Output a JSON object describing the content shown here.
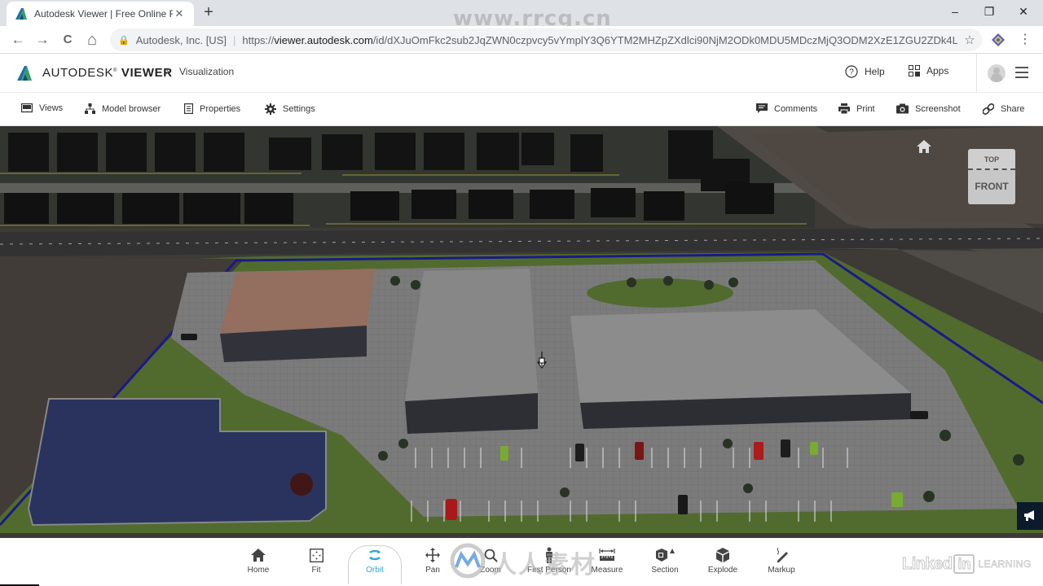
{
  "browser": {
    "tab_title": "Autodesk Viewer | Free Online Fi",
    "tab_close": "✕",
    "new_tab": "+",
    "watermark": "www.rrcg.cn",
    "window_controls": {
      "minimize": "–",
      "restore": "❐",
      "close": "✕"
    },
    "nav": {
      "back": "←",
      "forward": "→",
      "reload": "C",
      "home": "⌂"
    },
    "omnibox": {
      "lock": "🔒",
      "site_identity": "Autodesk, Inc. [US]",
      "separator": "|",
      "url_prefix": "https://",
      "url_host": "viewer.autodesk.com",
      "url_path": "/id/dXJuOmFkc2sub2JqZWN0czpvcy5vYmplY3Q6YTM2MHZpZXdlci90NjM2ODk0MDU5MDczMjQ3ODM2XzE1ZGU2ZDk4L...",
      "star": "☆"
    },
    "menu": "⋮"
  },
  "app": {
    "brand_prefix": "AUTODESK",
    "brand_mark": "®",
    "brand_product": "VIEWER",
    "breadcrumb_chevron": "›",
    "breadcrumb": "Visualization",
    "header_actions": [
      {
        "id": "help",
        "label": "Help",
        "icon": "help-circle-icon"
      },
      {
        "id": "apps",
        "label": "Apps",
        "icon": "apps-grid-icon"
      }
    ],
    "colors": {
      "accent": "#2fa8d8",
      "logo_green": "#3a9b6a",
      "logo_blue": "#1e6fa8"
    }
  },
  "subtoolbar": {
    "left": [
      {
        "id": "views",
        "label": "Views",
        "icon": "monitor-icon"
      },
      {
        "id": "model-browser",
        "label": "Model browser",
        "icon": "hierarchy-icon"
      },
      {
        "id": "properties",
        "label": "Properties",
        "icon": "document-icon"
      },
      {
        "id": "settings",
        "label": "Settings",
        "icon": "gear-icon"
      }
    ],
    "right": [
      {
        "id": "comments",
        "label": "Comments",
        "icon": "comment-icon"
      },
      {
        "id": "print",
        "label": "Print",
        "icon": "printer-icon"
      },
      {
        "id": "screenshot",
        "label": "Screenshot",
        "icon": "camera-icon"
      },
      {
        "id": "share",
        "label": "Share",
        "icon": "link-icon"
      }
    ]
  },
  "viewcube": {
    "top": "TOP",
    "front": "FRONT"
  },
  "tools": [
    {
      "id": "home",
      "label": "Home",
      "icon": "home-icon",
      "active": false
    },
    {
      "id": "fit",
      "label": "Fit",
      "icon": "fit-icon",
      "active": false
    },
    {
      "id": "orbit",
      "label": "Orbit",
      "icon": "orbit-icon",
      "active": true
    },
    {
      "id": "pan",
      "label": "Pan",
      "icon": "pan-icon",
      "active": false
    },
    {
      "id": "zoom",
      "label": "Zoom",
      "icon": "zoom-icon",
      "active": false
    },
    {
      "id": "first-person",
      "label": "First Person",
      "icon": "person-icon",
      "active": false
    },
    {
      "id": "measure",
      "label": "Measure",
      "icon": "ruler-icon",
      "active": false
    },
    {
      "id": "section",
      "label": "Section",
      "icon": "section-cube-icon",
      "active": false
    },
    {
      "id": "explode",
      "label": "Explode",
      "icon": "explode-cube-icon",
      "active": false
    },
    {
      "id": "markup",
      "label": "Markup",
      "icon": "pen-icon",
      "active": false
    }
  ],
  "branding": {
    "linkedin_word": "Linked",
    "linkedin_box": "in",
    "linkedin_learning": "LEARNING",
    "cn_watermark": "人人素材"
  }
}
